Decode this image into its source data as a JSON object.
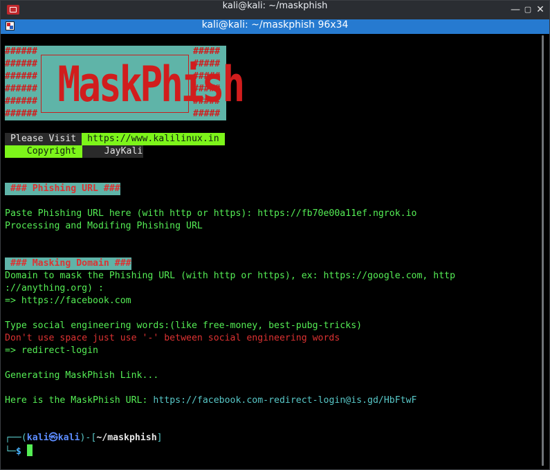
{
  "window": {
    "title": "kali@kali: ~/maskphish"
  },
  "tab": {
    "title": "kali@kali: ~/maskphish 96x34"
  },
  "banner": {
    "hash_left": "######\n######\n######\n######\n######\n######",
    "hash_right": "#####\n#####\n#####\n#####\n#####\n#####",
    "title": "MaskPhish"
  },
  "info": {
    "visit_label": " Please Visit ",
    "visit_url": " https://www.kalilinux.in ",
    "copyright_label": "    Copyright ",
    "copyright_value": "    JayKali    "
  },
  "phishing": {
    "header": " ### Phishing URL ###",
    "prompt_line": "Paste Phishing URL here (with http or https): https://fb70e00a11ef.ngrok.io",
    "processing": "Processing and Modifing Phishing URL"
  },
  "masking": {
    "header": " ### Masking Domain ###",
    "line1": "Domain to mask the Phishing URL (with http or https), ex: https://google.com, http",
    "line2": "://anything.org) :",
    "answer": "=> https://facebook.com"
  },
  "social": {
    "question": "Type social engineering words:(like free-money, best-pubg-tricks)",
    "warning": "Don't use space just use '-' between social engineering words",
    "answer": "=> redirect-login"
  },
  "generating": "Generating MaskPhish Link...",
  "result": {
    "label": "Here is the MaskPhish URL: ",
    "url": "https://facebook.com-redirect-login@is.gd/HbFtwF"
  },
  "prompt": {
    "open": "┌──(",
    "user": "kali",
    "at": "㉿",
    "host": "kali",
    "mid": ")-[",
    "dir": "~/maskphish",
    "close": "]",
    "second": "└─",
    "dollar": "$ "
  }
}
